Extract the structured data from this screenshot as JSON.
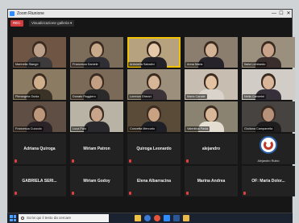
{
  "window": {
    "title": "Zoom Riunione",
    "controls": {
      "minimize": "—",
      "maximize": "☐",
      "close": "✕"
    }
  },
  "toolbar": {
    "record_label": "REC",
    "view_label": "Visualizzazione galleria ▾"
  },
  "colors": {
    "zoom_blue": "#2d8cff",
    "active_speaker": "#f2c200",
    "muted_red": "#e04040",
    "window_bg": "#161616"
  },
  "participants": {
    "row1": [
      {
        "name": "Marinella Stangò",
        "kind": "video",
        "palette": [
          "#6f5544",
          "#3d3a3c",
          "#bca08a"
        ]
      },
      {
        "name": "Francesca Daniele",
        "kind": "video",
        "palette": [
          "#7c6c5a",
          "#2e2e34",
          "#c8a98a"
        ]
      },
      {
        "name": "Antonella Sabatini",
        "kind": "video",
        "active": true,
        "palette": [
          "#b7a27f",
          "#222228",
          "#e6c9a8"
        ]
      },
      {
        "name": "Anna Maria",
        "kind": "video",
        "palette": [
          "#8b7e6e",
          "#26232a",
          "#d4b397"
        ]
      },
      {
        "name": "Ilaria Lombardo",
        "kind": "video",
        "palette": [
          "#9b8f7d",
          "#3a2e2c",
          "#caa38b"
        ]
      }
    ],
    "row2": [
      {
        "name": "Pierangela Guida",
        "kind": "video",
        "palette": [
          "#8c7b63",
          "#3a3226",
          "#cfae8c"
        ]
      },
      {
        "name": "Donato Ruggiero",
        "kind": "video",
        "palette": [
          "#7b6a58",
          "#2a2a2a",
          "#c29f83"
        ]
      },
      {
        "name": "Lorenza Ghezzi",
        "kind": "video",
        "palette": [
          "#9c8f7b",
          "#3b3338",
          "#d7b597"
        ]
      },
      {
        "name": "Maria Canale",
        "kind": "video",
        "palette": [
          "#c7bdb0",
          "#d9d3cb",
          "#e4c3a3"
        ]
      },
      {
        "name": "Nella Camerini",
        "kind": "video",
        "palette": [
          "#d1cdc6",
          "#35303a",
          "#d9b69a"
        ]
      }
    ],
    "row3": [
      {
        "name": "Francesca Cuocolo",
        "kind": "video",
        "palette": [
          "#5e4e44",
          "#2b2327",
          "#bd977b"
        ]
      },
      {
        "name": "Luca Palo",
        "kind": "video",
        "palette": [
          "#b9b3a6",
          "#2a2a2e",
          "#c7a48a"
        ]
      },
      {
        "name": "Concetta Mercurio",
        "kind": "video",
        "palette": [
          "#5a4b38",
          "#1f1f26",
          "#c9a183"
        ]
      },
      {
        "name": "Valentina Pavia",
        "kind": "video",
        "palette": [
          "#8a8372",
          "#e3ddd2",
          "#d8b898"
        ]
      },
      {
        "name": "Giuliana Campanella",
        "kind": "video",
        "palette": [
          "#474341",
          "#201d1f",
          "#b59279"
        ]
      }
    ],
    "row4": [
      {
        "name": "Adriana Quiroga",
        "kind": "text"
      },
      {
        "name": "Miriam Patron",
        "kind": "text"
      },
      {
        "name": "Quiroga Leonardo",
        "kind": "text"
      },
      {
        "name": "alejandro",
        "kind": "text"
      },
      {
        "name": "Alejandro Rubio",
        "kind": "logo"
      }
    ],
    "row5": [
      {
        "name": "GABRIELA SERI...",
        "kind": "text"
      },
      {
        "name": "Miriam Godoy",
        "kind": "text"
      },
      {
        "name": "Elena Albarracina",
        "kind": "text"
      },
      {
        "name": "Marina Andrea",
        "kind": "text"
      },
      {
        "name": "OF: Maria Dolor...",
        "kind": "text"
      }
    ]
  },
  "taskbar": {
    "search_placeholder": "Scrivi qui il testo da cercare",
    "app_icons": [
      "file-explorer-icon",
      "edge-icon",
      "chrome-icon",
      "zoom-icon",
      "word-icon",
      "folder-icon"
    ]
  }
}
